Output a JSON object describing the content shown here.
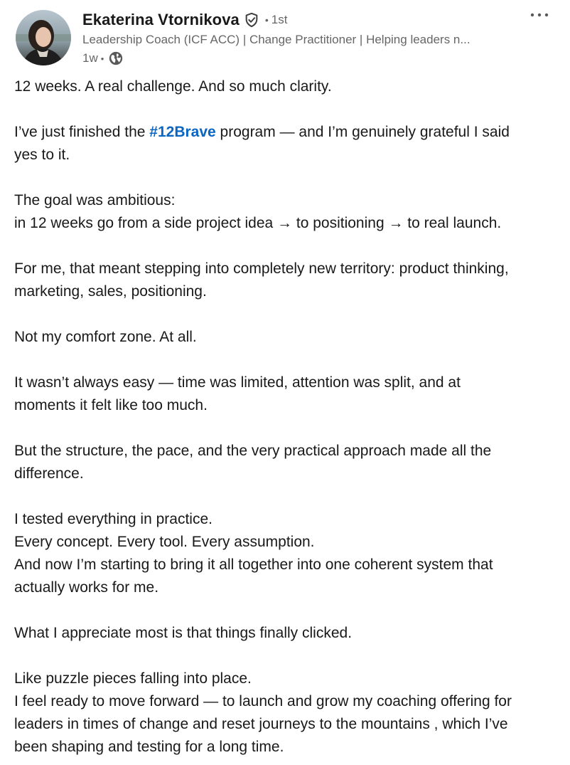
{
  "author": {
    "name": "Ekaterina Vtornikova",
    "degree": "1st",
    "separator": "•",
    "headline": "Leadership Coach (ICF ACC) | Change Practitioner | Helping leaders n...",
    "time": "1w",
    "time_separator": "•"
  },
  "icons": {
    "verified": "verified-shield-icon",
    "visibility": "globe-icon",
    "more": "more-options-icon"
  },
  "colors": {
    "hashtag": "#0a66c2",
    "text": "#191919",
    "secondary": "#666666"
  },
  "post": {
    "p1": {
      "l1": "12 weeks. A real challenge. And so much clarity."
    },
    "p2": {
      "l1_before": "I’ve just finished the ",
      "l1_hashtag": "#12Brave",
      "l1_after": " program — and I’m genuinely grateful I said",
      "l2": "yes to it."
    },
    "p3": {
      "l1": "The goal was ambitious:",
      "l2": "in 12 weeks go from a side project idea → to positioning → to real launch."
    },
    "p4": {
      "l1": "For me, that meant stepping into completely new territory: product thinking,",
      "l2": "marketing, sales, positioning."
    },
    "p5": {
      "l1": "Not my comfort zone. At all."
    },
    "p6": {
      "l1": "It wasn’t always easy — time was limited, attention was split, and at",
      "l2": "moments it felt like too much."
    },
    "p7": {
      "l1": "But the structure, the pace, and the very practical approach made all the",
      "l2": "difference."
    },
    "p8": {
      "l1": "I tested everything in practice.",
      "l2": "Every concept. Every tool. Every assumption.",
      "l3": "And now I’m starting to bring it all together into one coherent system that",
      "l4": "actually works for me."
    },
    "p9": {
      "l1": "What I appreciate most is that things finally clicked."
    },
    "p10": {
      "l1": "Like puzzle pieces falling into place.",
      "l2": "I feel ready to move forward — to launch and grow my coaching offering for",
      "l3": "leaders in times of change and reset journeys to the mountains , which I’ve",
      "l4": "been shaping and testing for a long time."
    }
  }
}
